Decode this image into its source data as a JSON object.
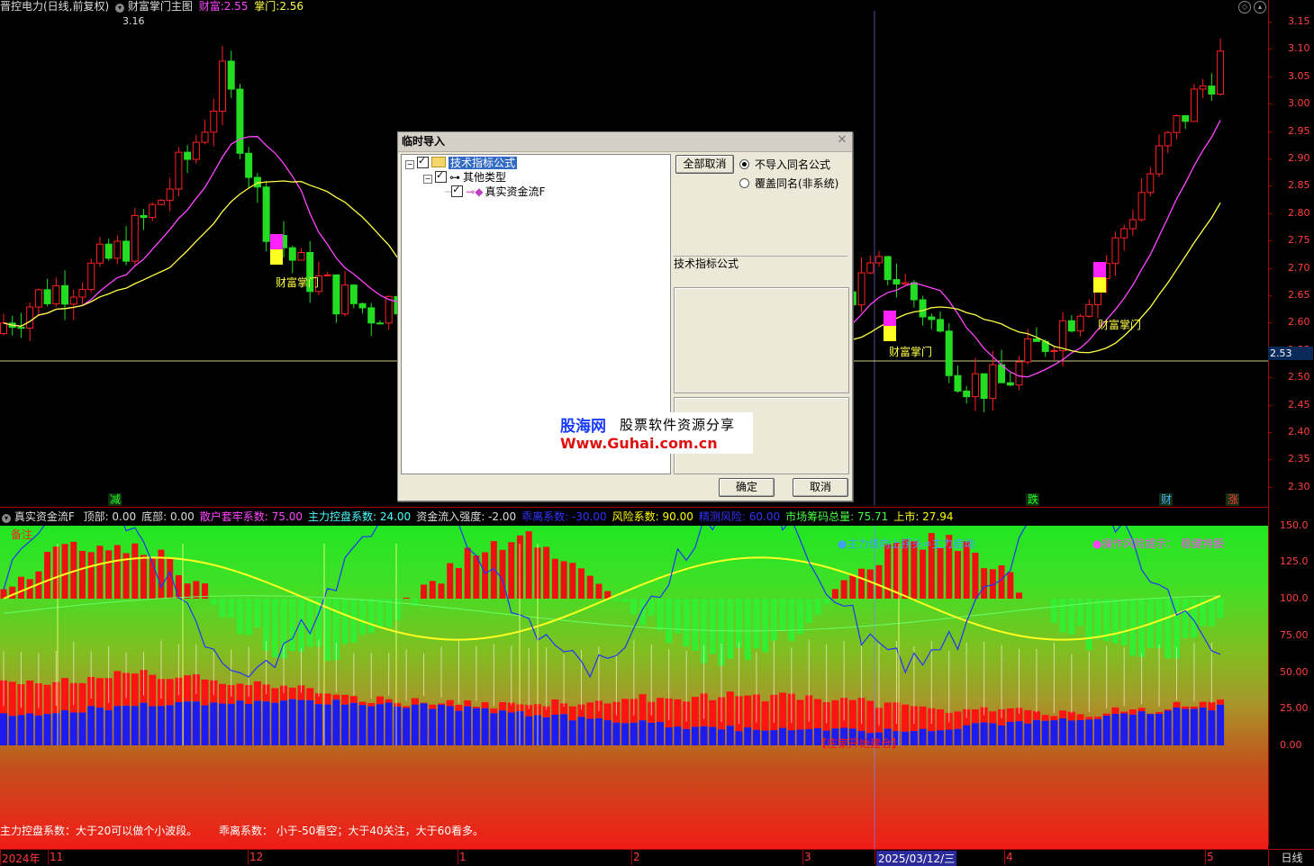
{
  "title_bar": {
    "stock": "晋控电力(日线,前复权)",
    "indicator": "财富掌门主图",
    "wealth_label": "财富:",
    "wealth_value": "2.55",
    "gate_label": "掌门:",
    "gate_value": "2.56"
  },
  "price_axis": [
    "3.15",
    "3.10",
    "3.05",
    "3.00",
    "2.95",
    "2.90",
    "2.85",
    "2.80",
    "2.75",
    "2.70",
    "2.65",
    "2.60",
    "2.55",
    "2.50",
    "2.45",
    "2.40",
    "2.35",
    "2.30"
  ],
  "current_price": "2.53",
  "high_annotation": "3.16",
  "chart_labels": [
    "财富掌门",
    "财富掌门",
    "财富掌门"
  ],
  "signals": [
    "减",
    "跌",
    "财",
    "涨"
  ],
  "indicator_header": {
    "name": "真实资金流F",
    "items": [
      {
        "label": "顶部:",
        "value": "0.00",
        "color": "#dddddd"
      },
      {
        "label": "底部:",
        "value": "0.00",
        "color": "#dddddd"
      },
      {
        "label": "散户套牢系数:",
        "value": "75.00",
        "color": "#ff44ff"
      },
      {
        "label": "主力控盘系数:",
        "value": "24.00",
        "color": "#44ffff"
      },
      {
        "label": "资金流入强度:",
        "value": "-2.00",
        "color": "#dddddd"
      },
      {
        "label": "乖离系数:",
        "value": "-30.00",
        "color": "#3333ff"
      },
      {
        "label": "风险系数:",
        "value": "90.00",
        "color": "#ffff00"
      },
      {
        "label": "精测风险:",
        "value": "60.00",
        "color": "#3333ff"
      },
      {
        "label": "市场筹码总量:",
        "value": "75.71",
        "color": "#44ff44"
      },
      {
        "label": "上市:",
        "value": "27.94",
        "color": "#ffff00"
      }
    ]
  },
  "indicator_axis": [
    "150.0",
    "125.0",
    "100.0",
    "75.00",
    "50.00",
    "25.00",
    "0.00"
  ],
  "indicator_notes": {
    "beizhu": "备注",
    "left_note": "主力控盘系数：大于20可以做个小波段。",
    "right_note": "乖离系数： 小于-50看空；大于40关注，大于60看多。",
    "annot_main": "●主力线向上拐头=主力启动",
    "annot_op": "●操作风险提示：  稳健持股",
    "annot_red": "【庄家开始建仓】"
  },
  "time_axis": [
    "2024年",
    "11",
    "12",
    "1",
    "2",
    "3",
    "2025/03/12/三",
    "4",
    "5"
  ],
  "period": "日线",
  "dialog": {
    "title": "临时导入",
    "tree": [
      "技术指标公式",
      "其他类型",
      "真实资金流F"
    ],
    "cancel_all": "全部取消",
    "radio_no_import": "不导入同名公式",
    "radio_overwrite": "覆盖同名(非系统)",
    "group_label": "技术指标公式",
    "ok": "确定",
    "cancel": "取消"
  },
  "watermark": {
    "brand": "股海网",
    "slogan": "股票软件资源分享",
    "url": "Www.Guhai.com.cn"
  },
  "colors": {
    "up": "#ff2020",
    "down": "#22dd22",
    "ma_yellow": "#ffff44",
    "ma_magenta": "#ff44ff",
    "axis_red": "#ff3a3a"
  }
}
